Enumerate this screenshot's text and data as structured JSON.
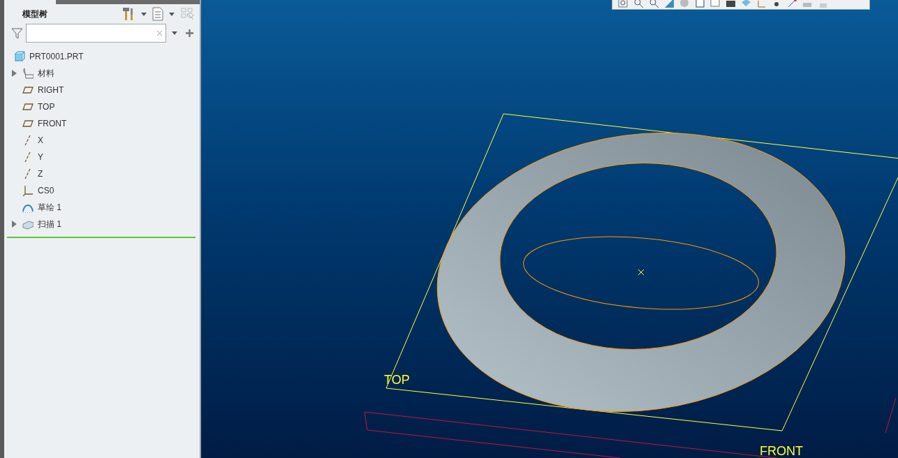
{
  "model_tree": {
    "title": "模型树",
    "items": [
      {
        "label": "PRT0001.PRT",
        "kind": "part",
        "expandable": false
      },
      {
        "label": "材料",
        "kind": "material",
        "expandable": true
      },
      {
        "label": "RIGHT",
        "kind": "plane",
        "expandable": false
      },
      {
        "label": "TOP",
        "kind": "plane",
        "expandable": false
      },
      {
        "label": "FRONT",
        "kind": "plane",
        "expandable": false
      },
      {
        "label": "X",
        "kind": "axis",
        "expandable": false
      },
      {
        "label": "Y",
        "kind": "axis",
        "expandable": false
      },
      {
        "label": "Z",
        "kind": "axis",
        "expandable": false
      },
      {
        "label": "CS0",
        "kind": "csys",
        "expandable": false
      },
      {
        "label": "草绘 1",
        "kind": "sketch",
        "expandable": false
      },
      {
        "label": "扫描 1",
        "kind": "sweep",
        "expandable": true
      }
    ]
  },
  "viewport": {
    "plane_labels": [
      "TOP",
      "FRONT"
    ]
  }
}
